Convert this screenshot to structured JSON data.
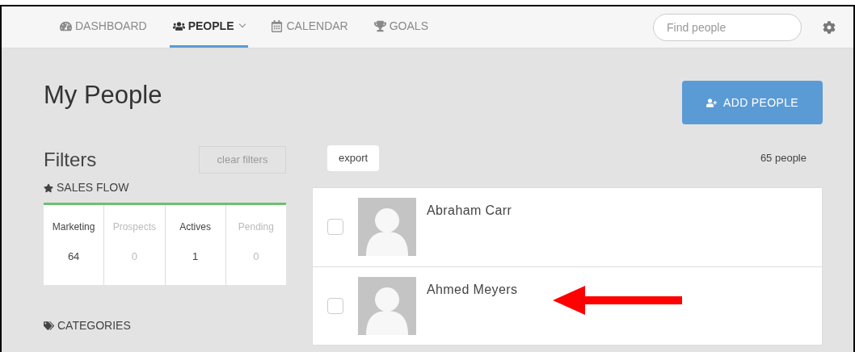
{
  "nav": {
    "items": [
      {
        "label": "DASHBOARD",
        "kind": "dashboard",
        "selected": false,
        "dropdown": false
      },
      {
        "label": "PEOPLE",
        "kind": "people",
        "selected": true,
        "dropdown": true
      },
      {
        "label": "CALENDAR",
        "kind": "calendar",
        "selected": false,
        "dropdown": false
      },
      {
        "label": "GOALS",
        "kind": "trophy",
        "selected": false,
        "dropdown": false
      }
    ],
    "search": {
      "placeholder": "Find people"
    }
  },
  "page": {
    "title": "My People",
    "add_button": "ADD PEOPLE"
  },
  "filters": {
    "title": "Filters",
    "clear_button": "clear filters",
    "clear_disabled": true,
    "sales_flow": {
      "heading": "SALES FLOW",
      "stages": [
        {
          "label": "Marketing",
          "count": "64",
          "dimmed": false
        },
        {
          "label": "Prospects",
          "count": "0",
          "dimmed": true
        },
        {
          "label": "Actives",
          "count": "1",
          "dimmed": false
        },
        {
          "label": "Pending",
          "count": "0",
          "dimmed": true
        }
      ]
    },
    "categories": {
      "heading": "CATEGORIES"
    }
  },
  "list": {
    "export_button": "export",
    "count": "65 people",
    "people": [
      {
        "name": "Abraham Carr",
        "checked": false,
        "annotated": false
      },
      {
        "name": "Ahmed Meyers",
        "checked": false,
        "annotated": true
      }
    ]
  }
}
